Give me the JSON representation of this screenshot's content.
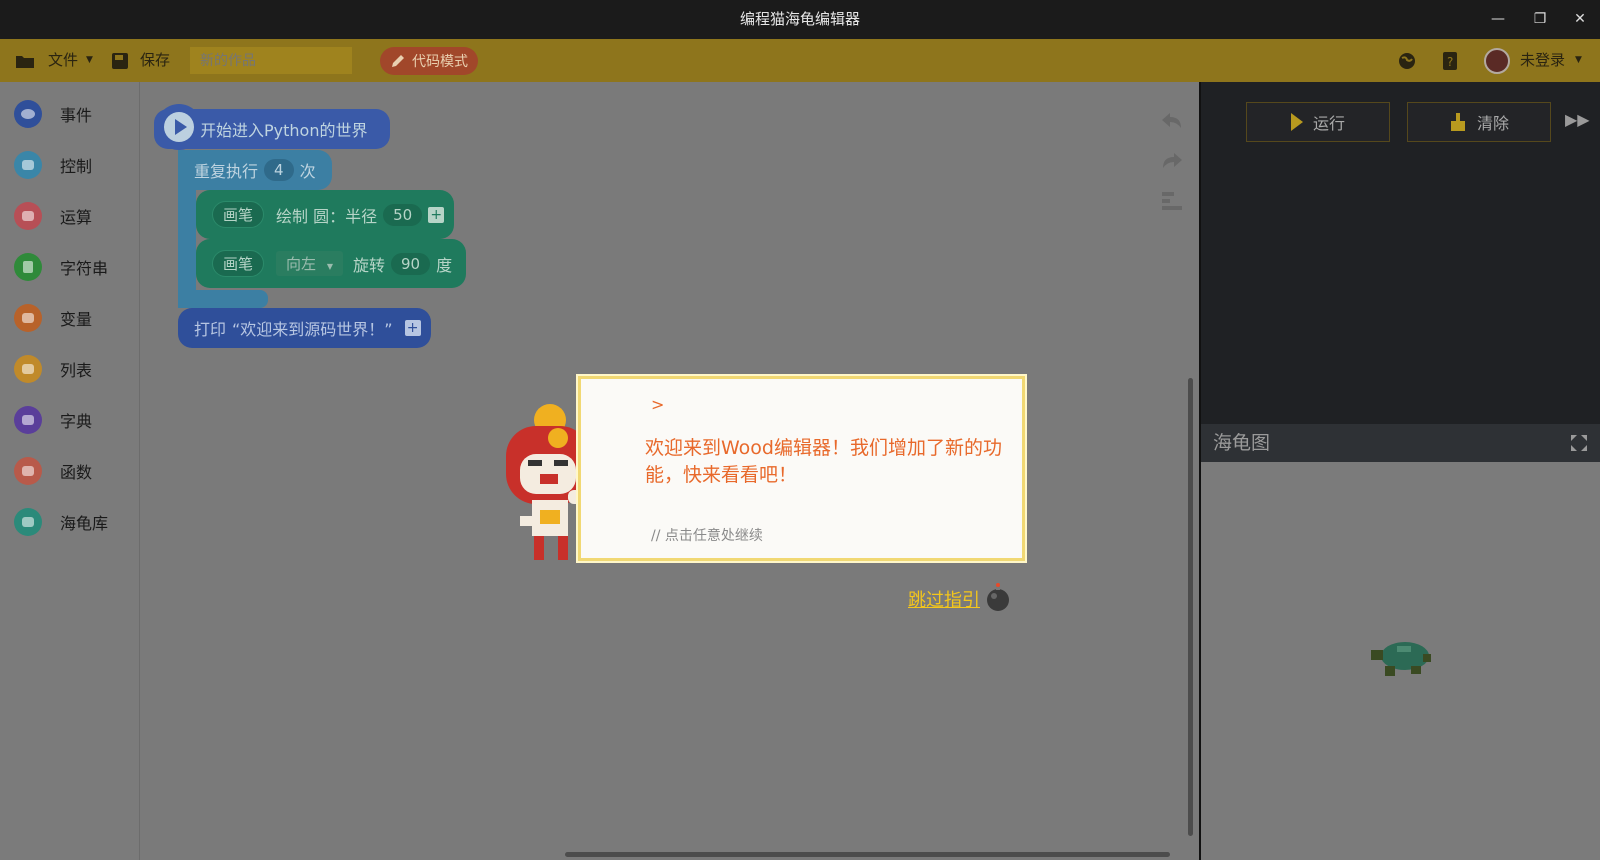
{
  "window": {
    "title": "编程猫海龟编辑器",
    "minimize_glyph": "—",
    "restore_glyph": "❐",
    "close_glyph": "✕"
  },
  "toolbar": {
    "file_label": "文件",
    "save_label": "保存",
    "work_name_placeholder": "新的作品",
    "code_mode_label": "代码模式",
    "user_label": "未登录"
  },
  "sidebar": {
    "items": [
      {
        "label": "事件",
        "icon": "eye-icon",
        "color": "#2f4f9a"
      },
      {
        "label": "控制",
        "icon": "gamepad-icon",
        "color": "#3a86a8"
      },
      {
        "label": "运算",
        "icon": "grid-icon",
        "color": "#b74f56"
      },
      {
        "label": "字符串",
        "icon": "letter-a-icon",
        "color": "#2f8a3a"
      },
      {
        "label": "变量",
        "icon": "x-icon",
        "color": "#b8622a"
      },
      {
        "label": "列表",
        "icon": "list-icon",
        "color": "#c08a2a"
      },
      {
        "label": "字典",
        "icon": "book-icon",
        "color": "#5a3e9a"
      },
      {
        "label": "函数",
        "icon": "code-icon",
        "color": "#b85a4a"
      },
      {
        "label": "海龟库",
        "icon": "turtle-icon",
        "color": "#2b8a7a"
      }
    ]
  },
  "blocks": {
    "start": "开始进入Python的世界",
    "repeat_prefix": "重复执行",
    "repeat_count": "4",
    "repeat_suffix": "次",
    "pen_label": "画笔",
    "circle_label": "绘制 圆：半径",
    "circle_radius": "50",
    "direction": "向左",
    "rotate_label": "旋转",
    "rotate_degrees": "90",
    "degree_label": "度",
    "print_prefix": "打印",
    "print_text": "“欢迎来到源码世界！”"
  },
  "right_panel": {
    "run_label": "运行",
    "clear_label": "清除",
    "turtle_title": "海龟图"
  },
  "guide": {
    "prompt": ">",
    "message": "欢迎来到Wood编辑器！我们增加了新的功能，快来看看吧！",
    "hint": "// 点击任意处继续",
    "skip_label": "跳过指引"
  }
}
